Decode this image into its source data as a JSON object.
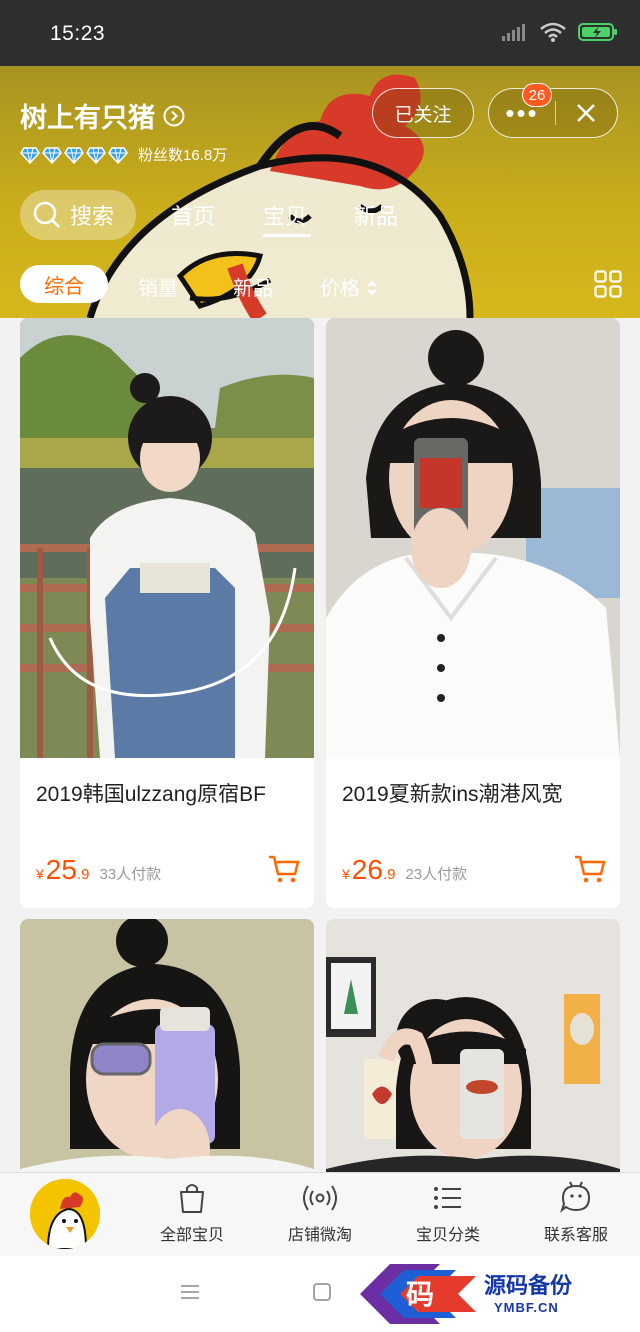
{
  "status_bar": {
    "time": "15:23"
  },
  "shop": {
    "name": "树上有只猪",
    "fans": "粉丝数16.8万",
    "follow_label": "已关注",
    "more_label": "•••",
    "message_badge": "26"
  },
  "top_tabs": {
    "search_label": "搜索",
    "items": [
      "首页",
      "宝贝",
      "新品"
    ],
    "active": "宝贝"
  },
  "sort_bar": {
    "items": [
      "综合",
      "销量",
      "新品",
      "价格"
    ],
    "active": "综合"
  },
  "products": [
    {
      "title": "2019韩国ulzzang原宿BF",
      "yen": "¥",
      "price_int": "25",
      "price_dec": ".9",
      "sales": "33人付款"
    },
    {
      "title": "2019夏新款ins潮港风宽",
      "yen": "¥",
      "price_int": "26",
      "price_dec": ".9",
      "sales": "23人付款"
    },
    {
      "title": "",
      "yen": "",
      "price_int": "",
      "price_dec": "",
      "sales": ""
    },
    {
      "title": "",
      "yen": "",
      "price_int": "",
      "price_dec": "",
      "sales": ""
    }
  ],
  "bottom_nav": {
    "items": [
      "全部宝贝",
      "店铺微淘",
      "宝贝分类",
      "联系客服"
    ]
  },
  "watermark": {
    "char": "码",
    "title": "源码备份",
    "sub": "YMBF.CN"
  },
  "icons": {
    "status": [
      "signal-icon",
      "wifi-icon",
      "battery-icon"
    ],
    "header": [
      "chevron-right-circle-icon",
      "diamond-icon",
      "more-icon",
      "close-icon",
      "search-icon"
    ],
    "sort": [
      "sort-arrows-icon",
      "grid-view-icon"
    ],
    "card": [
      "cart-icon"
    ],
    "bottom_nav": [
      "bag-icon",
      "broadcast-icon",
      "list-icon",
      "chat-face-icon"
    ],
    "system": [
      "menu-icon",
      "home-square-icon"
    ]
  },
  "colors": {
    "accent": "#ff5000",
    "header": "#c9ad1b",
    "status_bar": "#2e2e2e"
  }
}
